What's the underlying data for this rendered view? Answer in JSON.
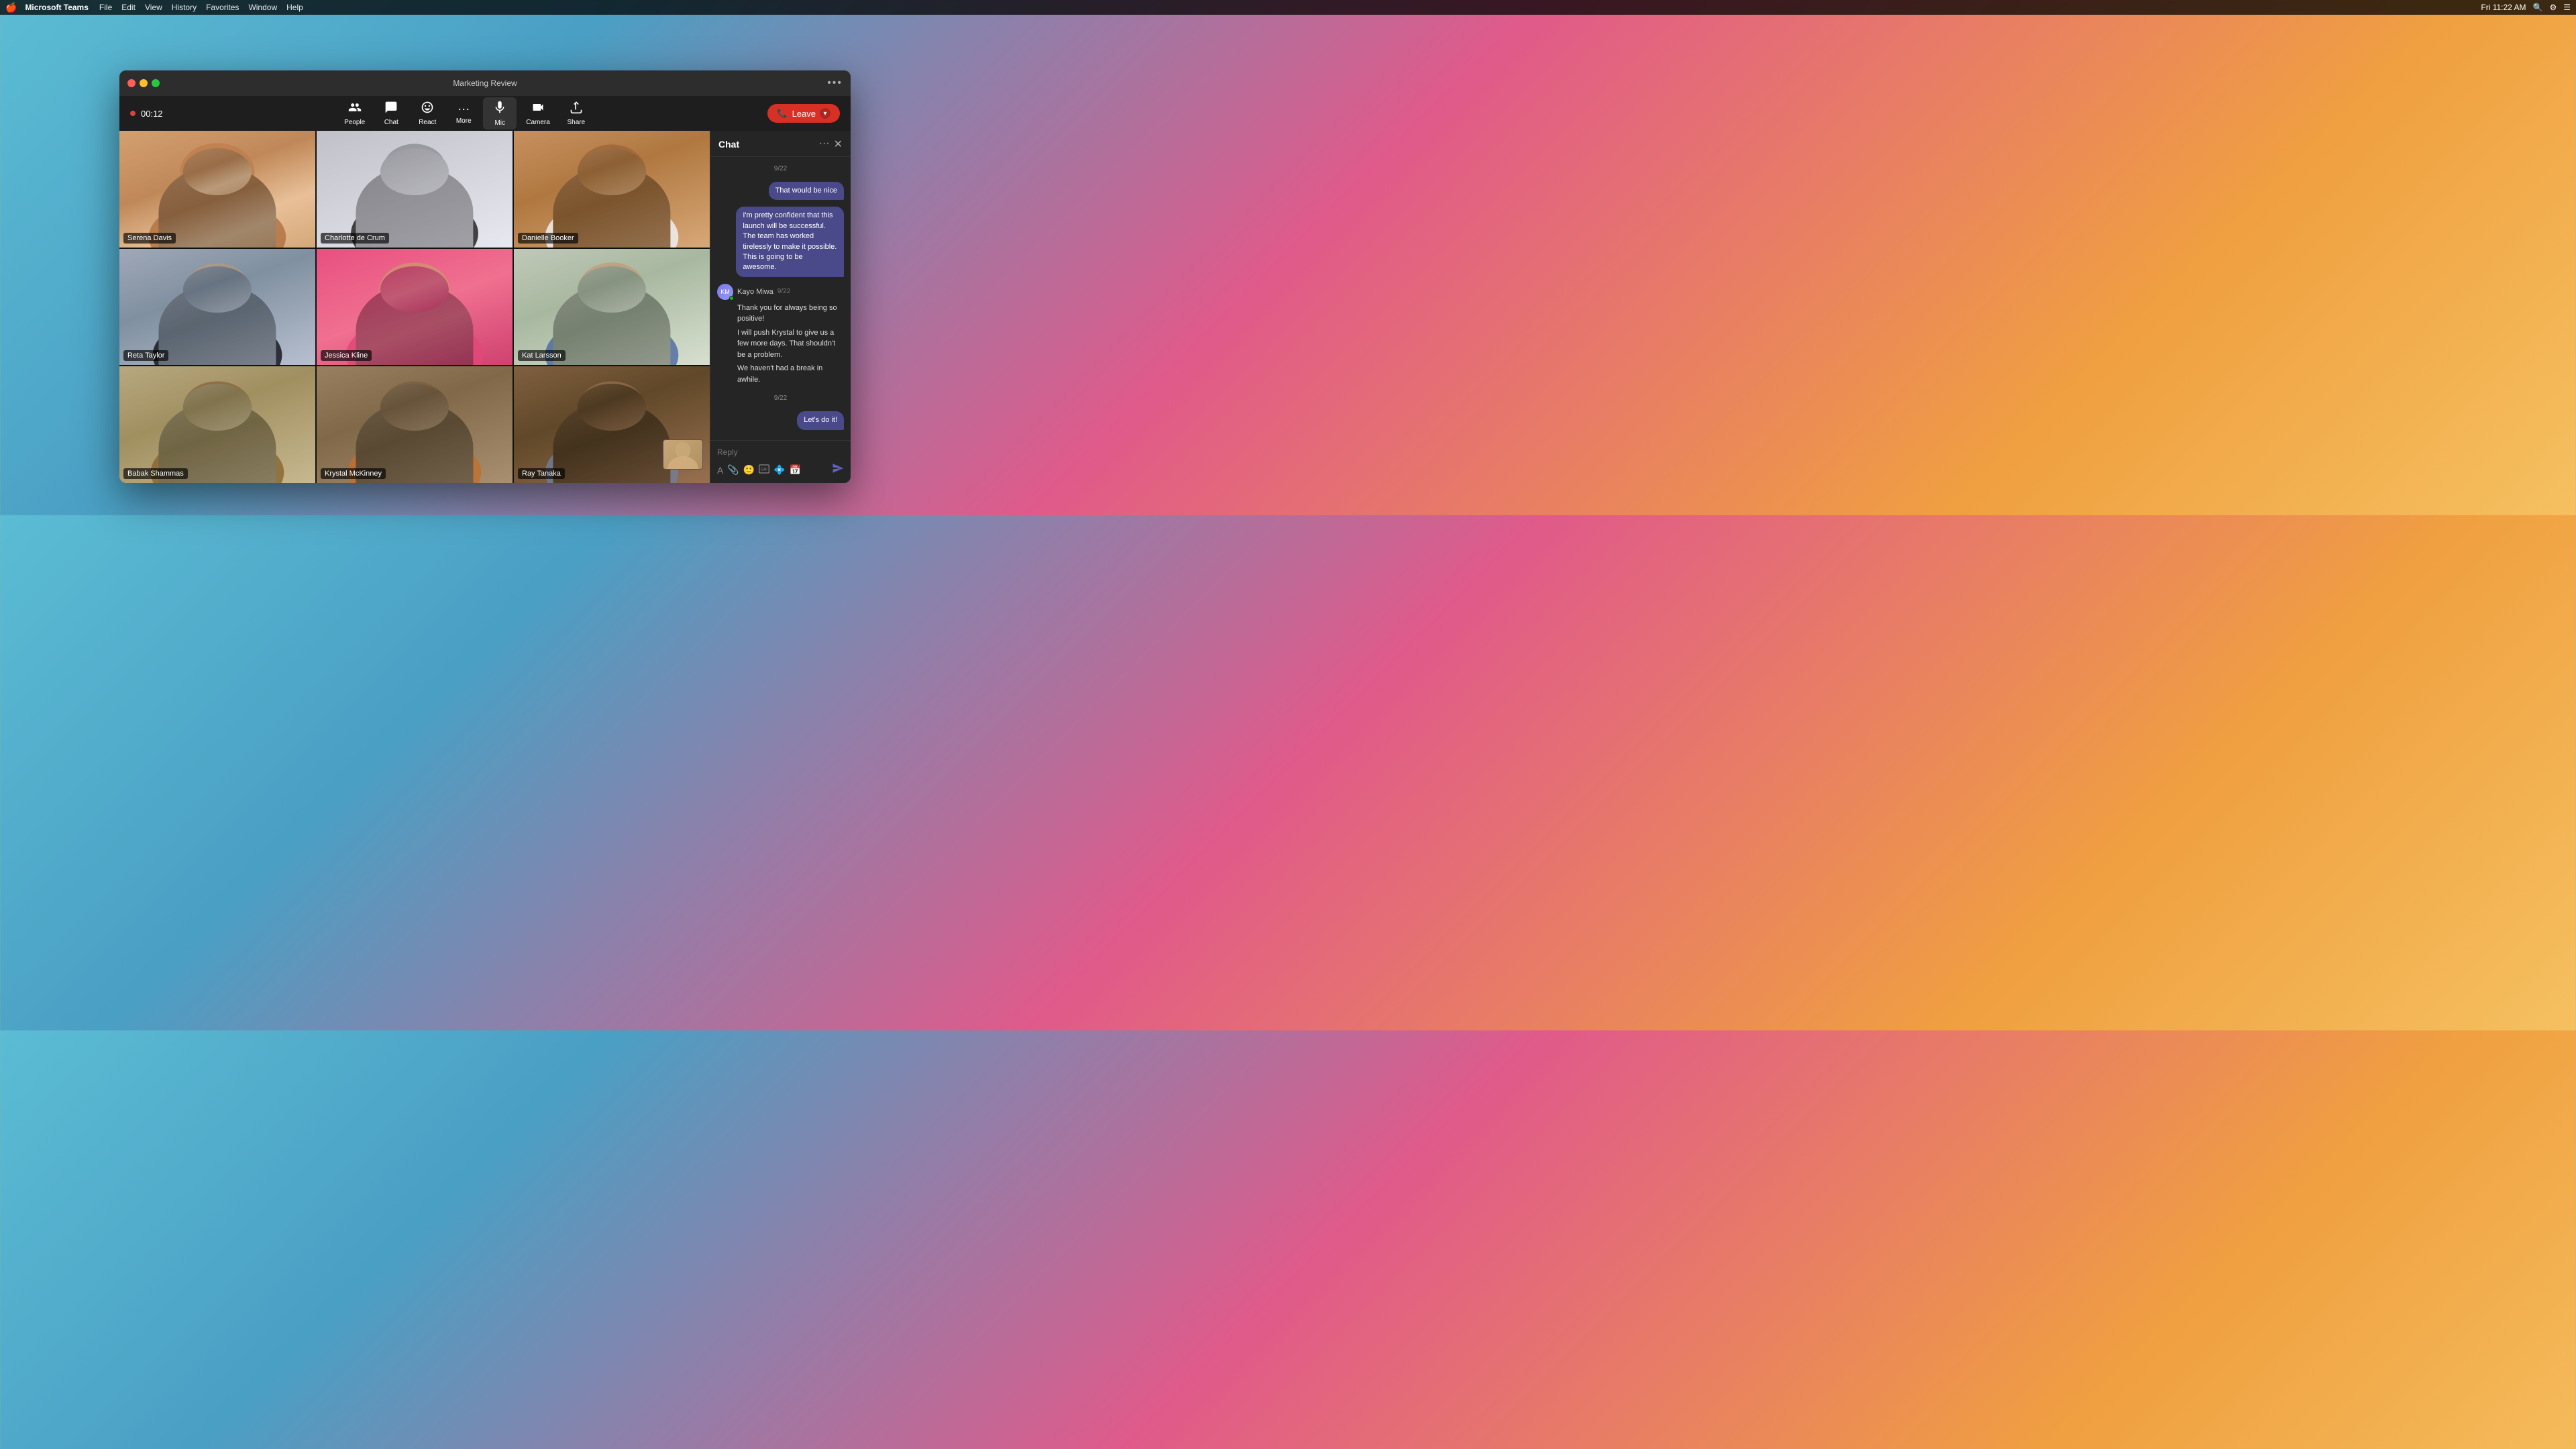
{
  "menubar": {
    "apple": "🍎",
    "appName": "Microsoft Teams",
    "items": [
      "File",
      "Edit",
      "View",
      "History",
      "Favorites",
      "Window",
      "Help"
    ],
    "time": "Fri 11:22 AM"
  },
  "window": {
    "title": "Marketing Review",
    "moreMenuLabel": "•••"
  },
  "toolbar": {
    "timer": "00:12",
    "buttons": [
      {
        "id": "people",
        "icon": "👥",
        "label": "People"
      },
      {
        "id": "chat",
        "icon": "💬",
        "label": "Chat"
      },
      {
        "id": "react",
        "icon": "😊",
        "label": "React"
      },
      {
        "id": "more",
        "icon": "•••",
        "label": "More"
      },
      {
        "id": "mic",
        "icon": "🎤",
        "label": "Mic"
      },
      {
        "id": "camera",
        "icon": "📷",
        "label": "Camera"
      },
      {
        "id": "share",
        "icon": "⬆",
        "label": "Share"
      }
    ],
    "leaveLabel": "Leave"
  },
  "participants": [
    {
      "id": "p1",
      "name": "Serena Davis",
      "bg": "bg-1"
    },
    {
      "id": "p2",
      "name": "Charlotte de Crum",
      "bg": "bg-2"
    },
    {
      "id": "p3",
      "name": "Danielle Booker",
      "bg": "bg-3"
    },
    {
      "id": "p4",
      "name": "Reta Taylor",
      "bg": "bg-4"
    },
    {
      "id": "p5",
      "name": "Jessica Kline",
      "bg": "bg-5"
    },
    {
      "id": "p6",
      "name": "Kat Larsson",
      "bg": "bg-6"
    },
    {
      "id": "p7",
      "name": "Babak Shammas",
      "bg": "bg-7"
    },
    {
      "id": "p8",
      "name": "Krystal McKinney",
      "bg": "bg-8"
    },
    {
      "id": "p9",
      "name": "Ray Tanaka",
      "bg": "bg-9",
      "hasPip": true
    }
  ],
  "chat": {
    "title": "Chat",
    "messages": [
      {
        "type": "date",
        "text": "9/22"
      },
      {
        "type": "right",
        "text": "That would be nice"
      },
      {
        "type": "right-block",
        "text": "I'm pretty confident that this launch will be successful. The team has worked tirelessly to make it possible. This is going to be awesome."
      },
      {
        "type": "left",
        "sender": "Kayo Miwa",
        "time": "9/22",
        "initials": "KM",
        "paragraphs": [
          "Thank you for always being so positive!",
          "I will push Krystal to give us a few more days. That shouldn't be a problem.",
          "We haven't had a break in awhile."
        ]
      },
      {
        "type": "date2",
        "text": "9/22"
      },
      {
        "type": "right2",
        "text": "Let's do it!"
      }
    ],
    "replyPlaceholder": "Reply"
  }
}
